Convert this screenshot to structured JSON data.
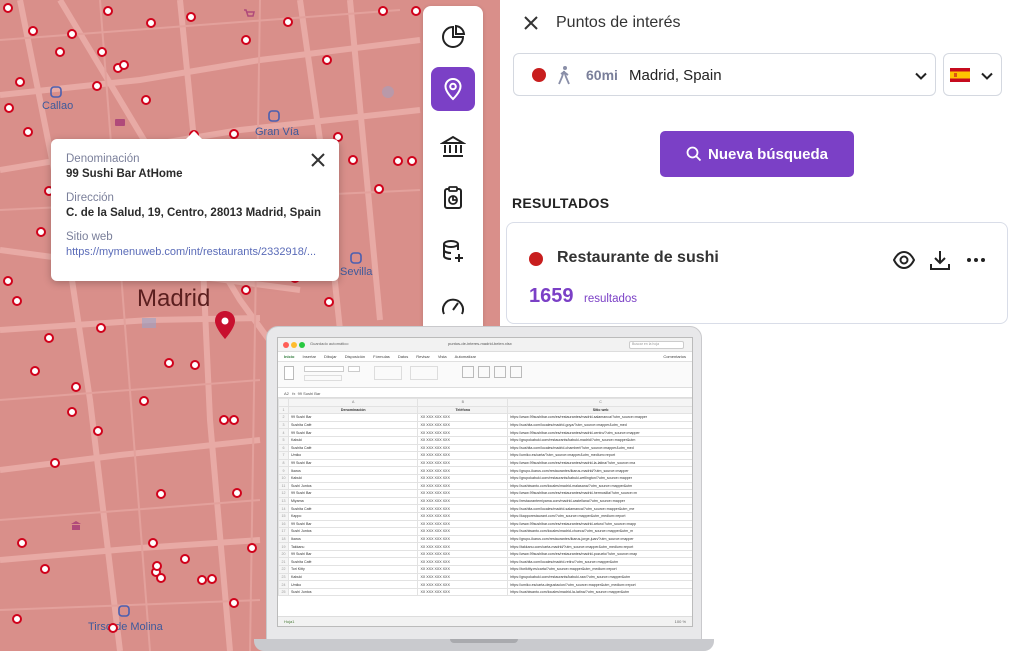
{
  "map": {
    "city_label": "Madrid",
    "place_labels": [
      {
        "id": "callao",
        "text": "Callao"
      },
      {
        "id": "granvia",
        "text": "Gran Vía"
      },
      {
        "id": "sevilla",
        "text": "Sevilla"
      },
      {
        "id": "tirso",
        "text": "Tirso de Molina"
      }
    ]
  },
  "popup": {
    "name_label": "Denominación",
    "name_value": "99 Sushi Bar AtHome",
    "address_label": "Dirección",
    "address_value": "C. de la Salud, 19, Centro, 28013 Madrid, Spain",
    "web_label": "Sitio web",
    "web_value": "https://mymenuweb.com/int/restaurants/2332918/..."
  },
  "toolbar": {
    "items": [
      {
        "icon": "pie-chart-icon",
        "active": false
      },
      {
        "icon": "location-pin-icon",
        "active": true
      },
      {
        "icon": "bank-icon",
        "active": false
      },
      {
        "icon": "clipboard-chart-icon",
        "active": false
      },
      {
        "icon": "database-add-icon",
        "active": false
      },
      {
        "icon": "gauge-icon",
        "active": false
      }
    ]
  },
  "panel": {
    "title": "Puntos de interés",
    "travel_mode_icon": "walking-icon",
    "distance": "60mi",
    "location": "Madrid, Spain",
    "country_flag": "spain-flag-icon",
    "search_button": "Nueva búsqueda",
    "results_header": "RESULTADOS",
    "result": {
      "title": "Restaurante de sushi",
      "count": "1659",
      "count_label": "resultados"
    }
  },
  "spreadsheet": {
    "filename": "puntos-de-interes-madrid-belen.xlsx",
    "autosave_label": "Guardado automático",
    "search_placeholder": "Buscar en la hoja",
    "menu": [
      "Inicio",
      "Insertar",
      "Dibujar",
      "Disposición",
      "Fórmulas",
      "Datos",
      "Revisar",
      "Vista",
      "Automatizar"
    ],
    "comments": "Comentarios",
    "cell_ref": "A2",
    "formula": "99 Sushi Bar",
    "columns": [
      "A",
      "B",
      "C"
    ],
    "headers": [
      "Denominación",
      "Teléfono",
      "Sitio web"
    ],
    "rows": [
      [
        "99 Sushi Bar",
        "XX XXX XXX XXX",
        "https://www.99sushibar.com/es/restaurantes/madrid-salamanca/?utm_source=mapper"
      ],
      [
        "Sushita Café",
        "XX XXX XXX XXX",
        "https://sushita.com/locales/madrid-goya/?utm_source=mapper&utm_med"
      ],
      [
        "99 Sushi Bar",
        "XX XXX XXX XXX",
        "https://www.99sushibar.com/es/restaurantes/madrid-centro/?utm_source=mapper"
      ],
      [
        "Kabuki",
        "XX XXX XXX XXX",
        "https://grupokabuki.com/restaurants/kabuki-madrid/?utm_source=mapper&utm"
      ],
      [
        "Sushita Café",
        "XX XXX XXX XXX",
        "https://sushita.com/locales/madrid-chamberi/?utm_source=mapper&utm_med"
      ],
      [
        "Umiko",
        "XX XXX XXX XXX",
        "https://umiko.es/carta/?utm_source=mapper&utm_medium=report"
      ],
      [
        "99 Sushi Bar",
        "XX XXX XXX XXX",
        "https://www.99sushibar.com/es/restaurantes/madrid-la-latina/?utm_source=ma"
      ],
      [
        "Ikarus",
        "XX XXX XXX XXX",
        "https://grupo-ikarus.com/restaurantes/ikarus-madrid/?utm_source=mapper"
      ],
      [
        "Kabuki",
        "XX XXX XXX XXX",
        "https://grupokabuki.com/restaurants/kabuki-wellington/?utm_source=mapper"
      ],
      [
        "Sushi Juntos",
        "XX XXX XXX XXX",
        "https://sushiwanto.com/locales/madrid-malasana/?utm_source=mapper&utm"
      ],
      [
        "99 Sushi Bar",
        "XX XXX XXX XXX",
        "https://www.99sushibar.com/es/restaurantes/madrid-hermosilla/?utm_source=m"
      ],
      [
        "Miyama",
        "XX XXX XXX XXX",
        "https://restaurantemiyama.com/madrid-castellana/?utm_source=mapper"
      ],
      [
        "Sushita Café",
        "XX XXX XXX XXX",
        "https://sushita.com/locales/madrid-salamanca/?utm_source=mapper&utm_me"
      ],
      [
        "Kappo",
        "XX XXX XXX XXX",
        "https://kapporestaurant.com/?utm_source=mapper&utm_medium=report"
      ],
      [
        "99 Sushi Bar",
        "XX XXX XXX XXX",
        "https://www.99sushibar.com/es/restaurantes/madrid-arturo/?utm_source=mapp"
      ],
      [
        "Sushi Juntos",
        "XX XXX XXX XXX",
        "https://sushiwanto.com/locales/madrid-chueca/?utm_source=mapper&utm_m"
      ],
      [
        "Ikarus",
        "XX XXX XXX XXX",
        "https://grupo-ikarus.com/restaurantes/ikarus-jorge-juan/?utm_source=mapper"
      ],
      [
        "Takkanu",
        "XX XXX XXX XXX",
        "https://takkanu.com/carta-madrid/?utm_source=mapper&utm_medium=report"
      ],
      [
        "99 Sushi Bar",
        "XX XXX XXX XXX",
        "https://www.99sushibar.com/es/restaurantes/madrid-pozuelo/?utm_source=map"
      ],
      [
        "Sushita Café",
        "XX XXX XXX XXX",
        "https://sushita.com/locales/madrid-retiro/?utm_source=mapper&utm"
      ],
      [
        "Tori Kitty",
        "XX XXX XXX XXX",
        "https://torikitty.es/carta/?utm_source=mapper&utm_medium=report"
      ],
      [
        "Kabuki",
        "XX XXX XXX XXX",
        "https://grupokabuki.com/restaurants/kabuki-raw/?utm_source=mapper&utm"
      ],
      [
        "Umiko",
        "XX XXX XXX XXX",
        "https://umiko.es/carta-degustacion/?utm_source=mapper&utm_medium=report"
      ],
      [
        "Sushi Juntos",
        "XX XXX XXX XXX",
        "https://sushiwanto.com/locales/madrid-la-latina/?utm_source=mapper&utm"
      ]
    ],
    "sheet_tab": "Hoja1",
    "status": "100 %",
    "status_left": "Listo  Accesibilidad: pruebe las sugerencias"
  }
}
